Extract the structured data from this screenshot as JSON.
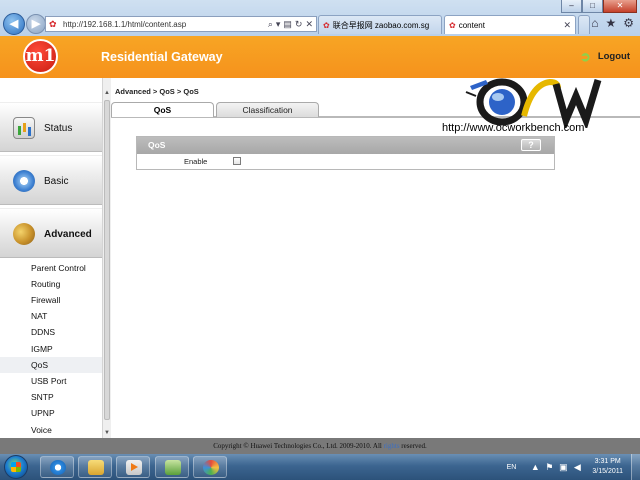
{
  "browser": {
    "address_url": "http://192.168.1.1/html/content.asp",
    "tabs": [
      {
        "label": "联合早报网 zaobao.com.sg"
      },
      {
        "label": "content"
      }
    ],
    "window_controls": {
      "minimize": "–",
      "maximize": "□",
      "close": "✕"
    }
  },
  "header": {
    "logo_text": "m1",
    "title": "Residential Gateway",
    "logout_label": "Logout"
  },
  "sidebar": {
    "sections": [
      {
        "label": "Status",
        "icon": "status-chart-icon"
      },
      {
        "label": "Basic",
        "icon": "basic-globe-icon"
      },
      {
        "label": "Advanced",
        "icon": "advanced-tools-icon",
        "active": true
      }
    ],
    "submenu": [
      {
        "label": "Parent Control"
      },
      {
        "label": "Routing"
      },
      {
        "label": "Firewall"
      },
      {
        "label": "NAT"
      },
      {
        "label": "DDNS"
      },
      {
        "label": "IGMP"
      },
      {
        "label": "QoS",
        "active": true
      },
      {
        "label": "USB Port"
      },
      {
        "label": "SNTP"
      },
      {
        "label": "UPNP"
      },
      {
        "label": "Voice"
      }
    ]
  },
  "main": {
    "breadcrumb": "Advanced > QoS > QoS",
    "tabs": [
      {
        "label": "QoS",
        "active": true
      },
      {
        "label": "Classification",
        "active": false
      }
    ],
    "watermark_url": "http://www.ocworkbench.com",
    "panel": {
      "title": "QoS",
      "help_label": "?",
      "enable_label": "Enable",
      "enable_checked": false
    }
  },
  "footer": {
    "text_before": "Copyright © Huawei Technologies Co., Ltd. 2009-2010. All ",
    "link_text": "rights",
    "text_after": " reserved."
  },
  "taskbar": {
    "language": "EN",
    "time": "3:31 PM",
    "date": "3/15/2011"
  },
  "colors": {
    "header_orange": "#f6921c",
    "footer_gray": "#797979",
    "panel_header_gray": "#b0b0b0"
  }
}
